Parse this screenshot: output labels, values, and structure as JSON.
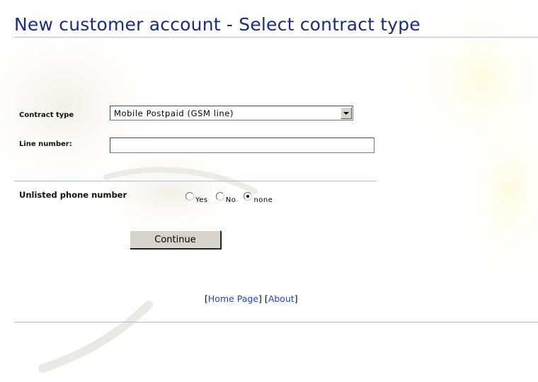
{
  "page": {
    "title": "New customer account - Select contract type"
  },
  "form": {
    "contract_type": {
      "label": "Contract type",
      "selected": "Mobile Postpaid (GSM line)"
    },
    "line_number": {
      "label": "Line number:",
      "value": ""
    },
    "unlisted_phone": {
      "label": "Unlisted phone number",
      "options": [
        {
          "label": "Yes",
          "checked": false
        },
        {
          "label": "No",
          "checked": false
        },
        {
          "label": "none",
          "checked": true
        }
      ]
    },
    "continue_label": "Continue"
  },
  "footer": {
    "bracket_open": "[",
    "bracket_close": "]",
    "home_link": "Home Page",
    "about_link": "About"
  },
  "colors": {
    "title": "#1a2c8a",
    "rule": "#a9bde0",
    "link": "#1d44c8",
    "button_face": "#d8d4cc"
  }
}
